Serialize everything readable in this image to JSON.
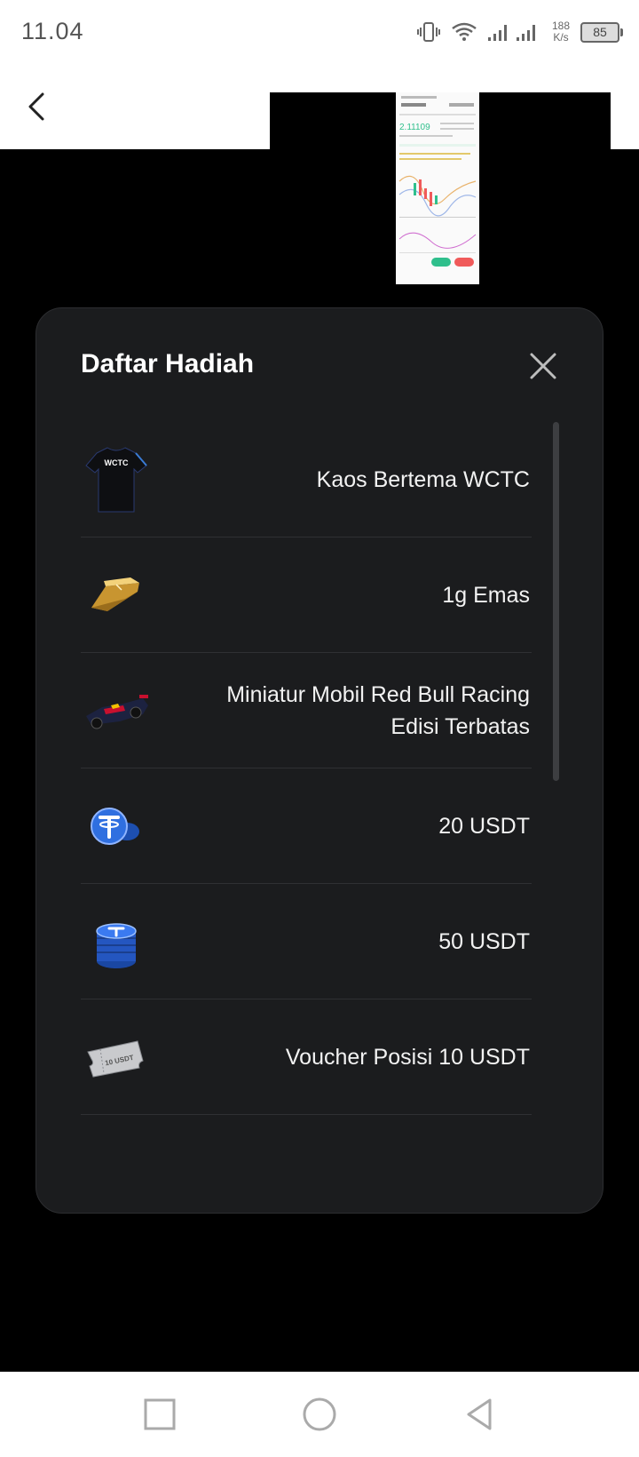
{
  "status": {
    "time": "11.04",
    "net_speed_value": "188",
    "net_speed_unit": "K/s",
    "battery": "85"
  },
  "header": {
    "back_icon": "chevron-left-icon"
  },
  "dialog": {
    "title": "Daftar Hadiah",
    "close_icon": "close-icon",
    "prizes": [
      {
        "label": "Kaos Bertema WCTC",
        "icon": "tshirt-icon",
        "icon_text": "WCTC"
      },
      {
        "label": "1g Emas",
        "icon": "gold-bar-icon"
      },
      {
        "label": "Miniatur Mobil Red Bull Racing Edisi Terbatas",
        "icon": "race-car-icon"
      },
      {
        "label": "20 USDT",
        "icon": "usdt-coin-icon"
      },
      {
        "label": "50 USDT",
        "icon": "usdt-coin-stack-icon"
      },
      {
        "label": "Voucher Posisi 10 USDT",
        "icon": "voucher-ticket-icon",
        "icon_text": "10 USDT"
      },
      {
        "label": "",
        "icon": "partial-item-icon"
      }
    ]
  },
  "thumbnail": {
    "price": "2.11109"
  },
  "nav": {
    "recent_icon": "square-icon",
    "home_icon": "circle-icon",
    "back_icon": "triangle-back-icon"
  },
  "colors": {
    "dialog_bg": "#1b1c1e",
    "usdt_blue": "#2f6fe0",
    "gold": "#d9a93a",
    "buy_green": "#2fbf8c",
    "sell_red": "#f05a5a"
  }
}
